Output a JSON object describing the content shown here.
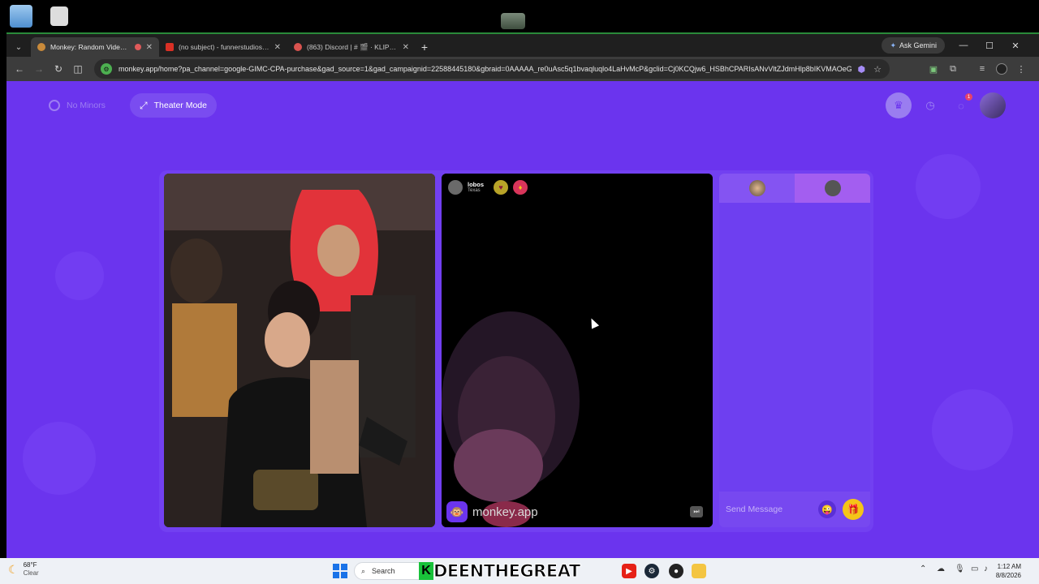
{
  "browser": {
    "tabs": [
      {
        "label": "Monkey: Random Video Ch",
        "active": true
      },
      {
        "label": "(no subject) - funnerstudios@g",
        "active": false
      },
      {
        "label": "(863) Discord | # 🎬 · KLIPZ | $p¢",
        "active": false
      }
    ],
    "ask_gemini": "Ask Gemini",
    "url": "monkey.app/home?pa_channel=google-GIMC-CPA-purchase&gad_source=1&gad_campaignid=22588445180&gbraid=0AAAAA_re0uAsc5q1bvaqluqlo4LaHvMcP&gclid=Cj0KCQjw6_HSBhCPARIsANvVltZJdmHlp8bIKVMAOeG..."
  },
  "app": {
    "no_minors_label": "No Minors",
    "theater_mode_label": "Theater Mode",
    "header_badge_count": "1",
    "peer": {
      "name": "lobos",
      "location": "Texas"
    },
    "watermark": "monkey.app",
    "chat_placeholder": "Send Message"
  },
  "taskbar": {
    "weather_temp": "68°F",
    "weather_condition": "Clear",
    "search_label": "Search",
    "banner_letter": "K",
    "banner_text": "DEENTHEGREAT",
    "time": "1:12 AM",
    "date": "8/8/2026"
  },
  "colors": {
    "page_bg": "#6b34ee",
    "accent_yellow": "#f5c518",
    "chrome_dark": "#202124"
  }
}
